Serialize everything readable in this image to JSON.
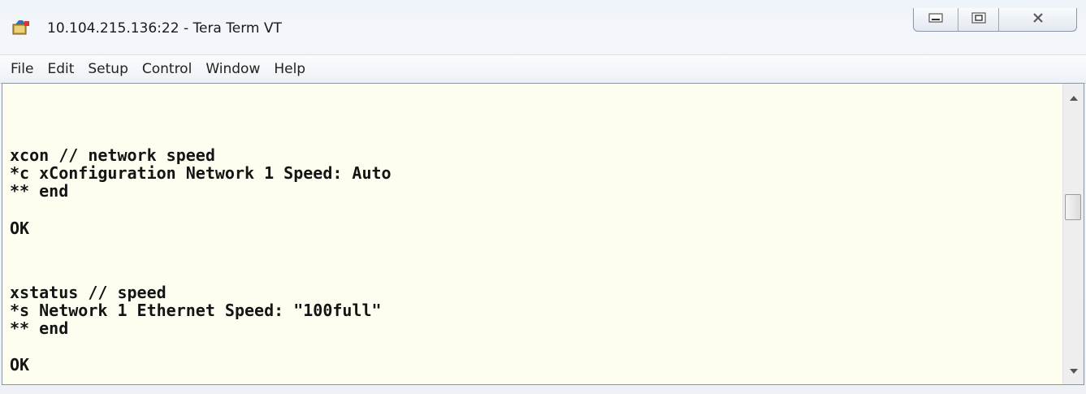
{
  "window": {
    "title": "10.104.215.136:22 - Tera Term VT",
    "app_icon": "tera-term-icon"
  },
  "caption_buttons": {
    "minimize_icon": "minimize-icon",
    "maximize_icon": "maximize-icon",
    "close_icon": "close-icon"
  },
  "menu": {
    "items": [
      {
        "label": "File"
      },
      {
        "label": "Edit"
      },
      {
        "label": "Setup"
      },
      {
        "label": "Control"
      },
      {
        "label": "Window"
      },
      {
        "label": "Help"
      }
    ]
  },
  "terminal": {
    "lines": [
      "xcon // network speed",
      "*c xConfiguration Network 1 Speed: Auto",
      "** end",
      "OK",
      "xstatus // speed",
      "*s Network 1 Ethernet Speed: \"100full\"",
      "** end",
      "OK"
    ],
    "background_color": "#fefef0",
    "text_color": "#141414"
  },
  "scrollbar": {
    "up_icon": "scroll-up-arrow-icon",
    "down_icon": "scroll-down-arrow-icon"
  }
}
